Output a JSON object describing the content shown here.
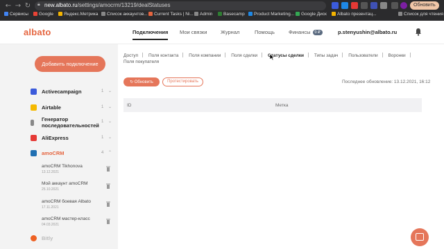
{
  "browser": {
    "url_host": "new.albato.ru",
    "url_path": "/settings/amocrm/13219/dealStatuses",
    "update_label": "Обновить",
    "bookmarks": [
      "Сервисы",
      "Google",
      "Яндекс.Метрика",
      "Список аккаунтов...",
      "Current Tasks | Ni...",
      "Admin",
      "Basecamp",
      "Product Marketing...",
      "Google Диск",
      "Albato презентац...",
      "Список для чтения"
    ]
  },
  "header": {
    "logo": "albato",
    "nav": [
      "Подключения",
      "Мои связки",
      "Журнал",
      "Помощь",
      "Финансы"
    ],
    "finance_badge": "0 ₽",
    "user_email": "p.stenyushin@albato.ru"
  },
  "sidebar": {
    "add_button": "Добавить подключение",
    "services": [
      {
        "name": "Activecampaign",
        "count": "1",
        "color": "#3b5bdb"
      },
      {
        "name": "Airtable",
        "count": "1",
        "color": "#f5b900"
      },
      {
        "name": "Генератор последовательностей",
        "count": "1",
        "color": "#888888"
      },
      {
        "name": "AliExpress",
        "count": "1",
        "color": "#e53935"
      },
      {
        "name": "amoCRM",
        "count": "4",
        "color": "#1f6fb2"
      },
      {
        "name": "Bitly",
        "count": "",
        "color": "#ee6123"
      }
    ],
    "accounts": [
      {
        "name": "amoCRM Tikhonova",
        "date": "13.12.2021"
      },
      {
        "name": "Мой аккаунт amoCRM",
        "date": "25.10.2021"
      },
      {
        "name": "amoCRM боевая Albato",
        "date": "17.11.2021"
      },
      {
        "name": "amoCRM мастер-класс",
        "date": "04.03.2021"
      }
    ]
  },
  "main": {
    "tabs_row1": [
      "Доступ",
      "Поля контакта",
      "Поля компании",
      "Поля сделки",
      "Статусы сделки",
      "Типы задач",
      "Пользователи",
      "Воронки"
    ],
    "tabs_row2": [
      "Поля покупателя"
    ],
    "active_tab": "Статусы сделки",
    "refresh_button": "Обновить",
    "test_button": "Протестировать",
    "last_update": "Последнее обновление: 13.12.2021, 16:12",
    "table_headers": [
      "ID",
      "Метка"
    ]
  }
}
